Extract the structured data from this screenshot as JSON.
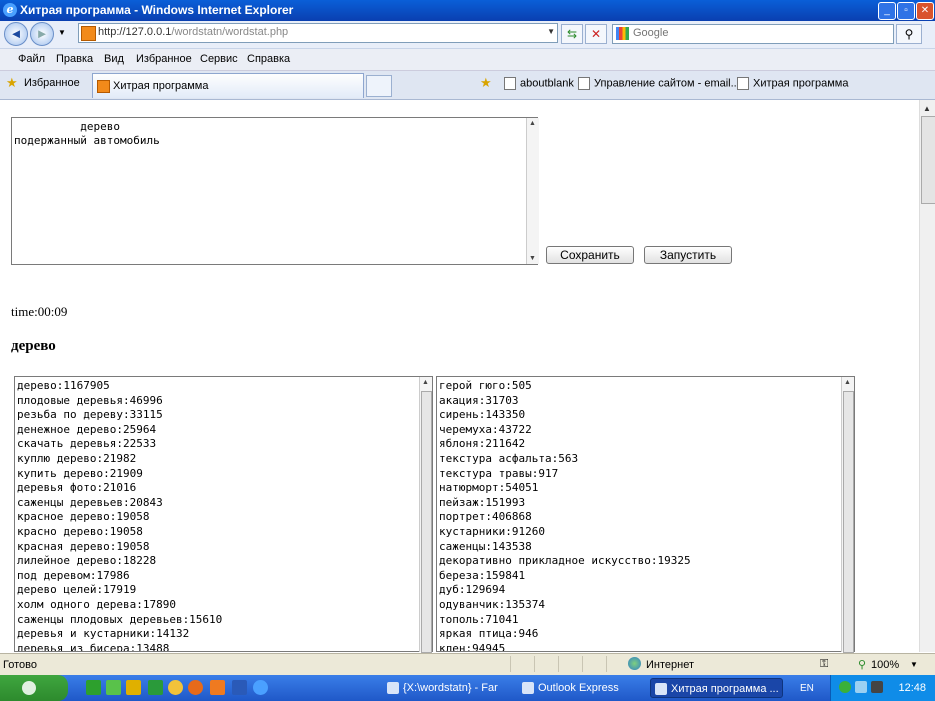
{
  "window": {
    "title": "Хитрая программа - Windows Internet Explorer"
  },
  "address_bar": {
    "url_host": "http://127.0.0.1",
    "url_path": "/wordstatn/wordstat.php"
  },
  "search": {
    "placeholder": "Google"
  },
  "menu": [
    "Файл",
    "Правка",
    "Вид",
    "Избранное",
    "Сервис",
    "Справка"
  ],
  "favorites_bar": {
    "favorites_label": "Избранное",
    "tab_label": "Хитрая программа",
    "links": [
      "aboutblank",
      "Управление сайтом - email...",
      "Хитрая программа"
    ]
  },
  "form": {
    "textarea_value": "          дерево\nподержанный автомобиль",
    "save_label": "Сохранить",
    "run_label": "Запустить"
  },
  "result": {
    "time": "time:00:09",
    "heading": "дерево",
    "left_list": [
      "дерево:1167905",
      "плодовые деревья:46996",
      "резьба по дереву:33115",
      "денежное дерево:25964",
      "скачать деревья:22533",
      "куплю дерево:21982",
      "купить дерево:21909",
      "деревья фото:21016",
      "саженцы деревьев:20843",
      "красное дерево:19058",
      "красно дерево:19058",
      "красная дерево:19058",
      "лилейное дерево:18228",
      "под деревом:17986",
      "дерево целей:17919",
      "холм одного дерева:17890",
      "саженцы плодовых деревьев:15610",
      "деревья и кустарники:14132",
      "деревья из бисера:13488"
    ],
    "right_list": [
      "герой гюго:505",
      "акация:31703",
      "сирень:143350",
      "черемуха:43722",
      "яблоня:211642",
      "текстура асфальта:563",
      "текстура травы:917",
      "натюрморт:54051",
      "пейзаж:151993",
      "портрет:406868",
      "кустарники:91260",
      "саженцы:143538",
      "декоративно прикладное искусство:19325",
      "береза:159841",
      "дуб:129694",
      "одуванчик:135374",
      "тополь:71041",
      "яркая птица:946",
      "клен:94945"
    ]
  },
  "status": {
    "text": "Готово",
    "zone": "Интернет",
    "zoom": "100%"
  },
  "taskbar": {
    "tasks": [
      "{X:\\wordstatn} - Far",
      "Outlook Express",
      "Хитрая программа ..."
    ],
    "lang": "EN",
    "clock": "12:48"
  }
}
